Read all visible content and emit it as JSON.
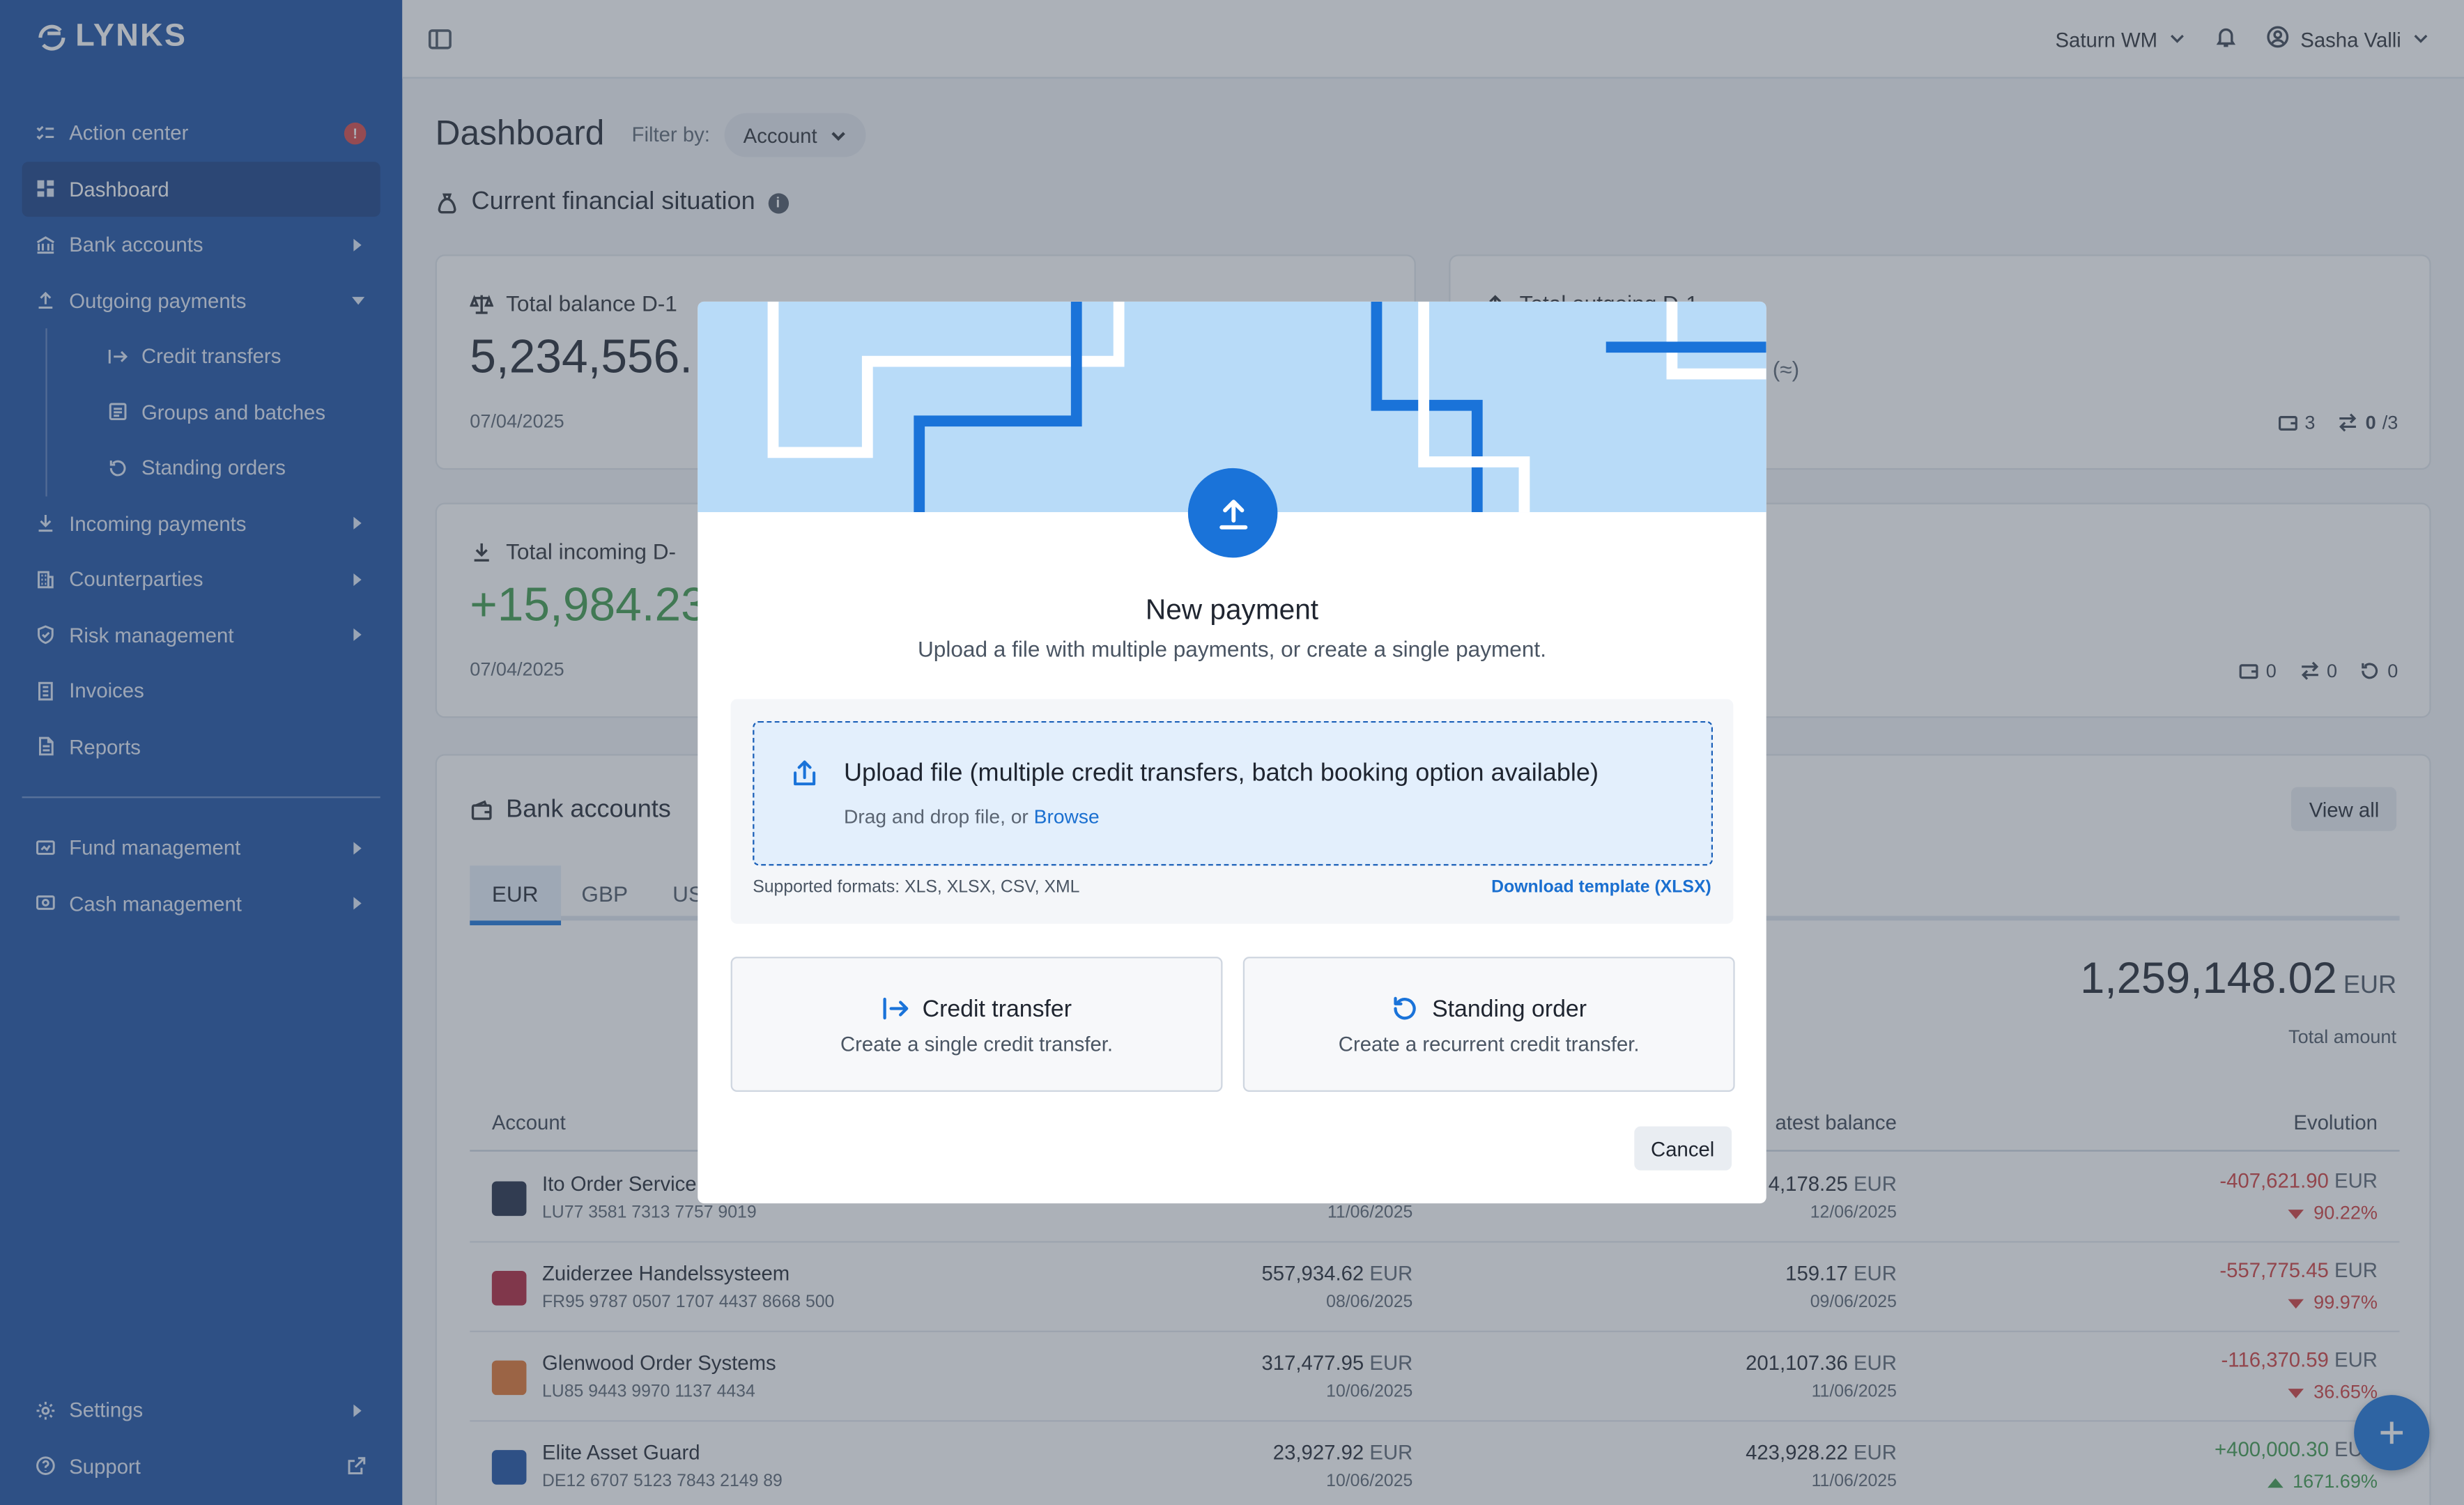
{
  "app": {
    "logo": "LYNKS"
  },
  "sidebar": {
    "items": [
      {
        "label": "Action center",
        "icon": "checklist-icon",
        "alert": "!"
      },
      {
        "label": "Dashboard",
        "icon": "dashboard-icon"
      },
      {
        "label": "Bank accounts",
        "icon": "bank-icon"
      },
      {
        "label": "Outgoing payments",
        "icon": "upload-icon"
      },
      {
        "label": "Credit transfers",
        "icon": "arrow-right-bar-icon"
      },
      {
        "label": "Groups and batches",
        "icon": "batch-icon"
      },
      {
        "label": "Standing orders",
        "icon": "refresh-icon"
      },
      {
        "label": "Incoming payments",
        "icon": "download-icon"
      },
      {
        "label": "Counterparties",
        "icon": "building-icon"
      },
      {
        "label": "Risk management",
        "icon": "shield-icon"
      },
      {
        "label": "Invoices",
        "icon": "invoice-icon"
      },
      {
        "label": "Reports",
        "icon": "report-icon"
      },
      {
        "label": "Fund management",
        "icon": "fund-icon"
      },
      {
        "label": "Cash management",
        "icon": "cash-icon"
      }
    ],
    "bottom": [
      {
        "label": "Settings",
        "icon": "gear-icon"
      },
      {
        "label": "Support",
        "icon": "help-icon"
      }
    ]
  },
  "topbar": {
    "org": "Saturn WM",
    "user": "Sasha Valli"
  },
  "dashboard": {
    "title": "Dashboard",
    "filter_label": "Filter by:",
    "filter_value": "Account",
    "section_title": "Current financial situation",
    "balance": {
      "label": "Total balance D-1",
      "value": "5,234,556.",
      "date": "07/04/2025"
    },
    "outgoing": {
      "label": "Total outgoing D-1",
      "approx": "(≈)",
      "c1": "3",
      "c2": "0",
      "c2b": "/3"
    },
    "incoming": {
      "label": "Total incoming D-",
      "value": "+15,984.23",
      "date": "07/04/2025",
      "c1": "0",
      "c2": "0",
      "c3": "0"
    },
    "bank_accounts": {
      "title": "Bank accounts",
      "view_all": "View all",
      "tabs": [
        "EUR",
        "GBP",
        "US"
      ],
      "total": "1,259,148.02",
      "total_currency": "EUR",
      "total_label": "Total amount",
      "columns": [
        "Account",
        "atest balance",
        "Evolution"
      ],
      "rows": [
        {
          "name": "Ito Order Service",
          "iban": "LU77 3581 7313 7757 9019",
          "b1": "",
          "d1": "11/06/2025",
          "b2": "4,178.25",
          "d2": "12/06/2025",
          "evo": "-407,621.90",
          "pct": "90.22%",
          "cur": "EUR",
          "logo_color": "#1f2a44"
        },
        {
          "name": "Zuiderzee Handelssysteem",
          "iban": "FR95 9787 0507 1707 4437 8668 500",
          "b1": "557,934.62",
          "d1": "08/06/2025",
          "b2": "159.17",
          "d2": "09/06/2025",
          "evo": "-557,775.45",
          "pct": "99.97%",
          "cur": "EUR",
          "logo_color": "#b0213a"
        },
        {
          "name": "Glenwood Order Systems",
          "iban": "LU85 9443 9970 1137 4434",
          "b1": "317,477.95",
          "d1": "10/06/2025",
          "b2": "201,107.36",
          "d2": "11/06/2025",
          "evo": "-116,370.59",
          "pct": "36.65%",
          "cur": "EUR",
          "logo_color": "#e0732e"
        },
        {
          "name": "Elite Asset Guard",
          "iban": "DE12 6707 5123 7843 2149 89",
          "b1": "23,927.92",
          "d1": "10/06/2025",
          "b2": "423,928.22",
          "d2": "11/06/2025",
          "evo": "+400,000.30",
          "pct": "1671.69%",
          "cur": "EUR",
          "logo_color": "#1a4fa3"
        }
      ]
    }
  },
  "modal": {
    "title": "New payment",
    "subtitle": "Upload a file with multiple payments, or create a single payment.",
    "upload_title": "Upload file (multiple credit transfers, batch booking option available)",
    "upload_hint": "Drag and drop file, or",
    "browse": "Browse",
    "formats": "Supported formats: XLS, XLSX, CSV, XML",
    "template": "Download template (XLSX)",
    "option1_title": "Credit transfer",
    "option1_desc": "Create a single credit transfer.",
    "option2_title": "Standing order",
    "option2_desc": "Create a recurrent credit transfer.",
    "cancel": "Cancel"
  },
  "colors": {
    "sidebar": "#1a4fa3",
    "accent": "#1a73d9",
    "positive": "#3d9a4a",
    "negative": "#cf3b3b"
  }
}
